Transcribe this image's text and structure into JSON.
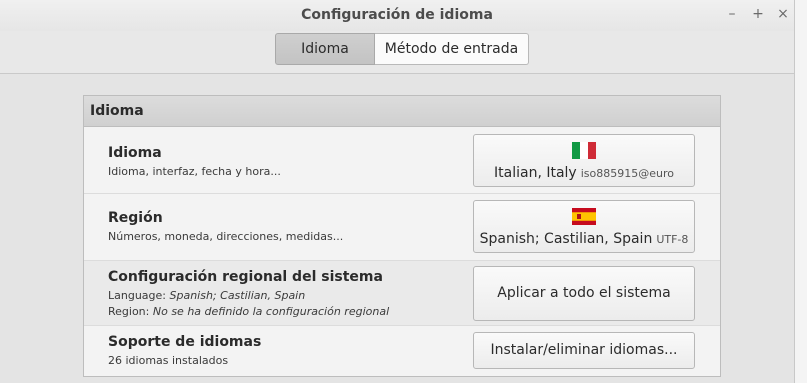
{
  "window": {
    "title": "Configuración de idioma",
    "controls": {
      "minimize": "–",
      "maximize": "+",
      "close": "×"
    }
  },
  "tabs": [
    {
      "label": "Idioma",
      "active": true
    },
    {
      "label": "Método de entrada",
      "active": false
    }
  ],
  "section": {
    "header": "Idioma"
  },
  "rows": {
    "language": {
      "title": "Idioma",
      "subtitle": "Idioma, interfaz, fecha y hora...",
      "button_main": "Italian, Italy",
      "button_secondary": "iso885915@euro",
      "flag_icon": "italy-flag-icon"
    },
    "region": {
      "title": "Región",
      "subtitle": "Números, moneda, direcciones, medidas...",
      "button_main": "Spanish; Castilian, Spain",
      "button_secondary": "UTF-8",
      "flag_icon": "spain-flag-icon"
    },
    "system": {
      "title": "Configuración regional del sistema",
      "language_label": "Language:",
      "language_value": "Spanish; Castilian, Spain",
      "region_label": "Region:",
      "region_value": "No se ha definido la configuración regional",
      "button": "Aplicar a todo el sistema"
    },
    "support": {
      "title": "Soporte de idiomas",
      "subtitle": "26 idiomas instalados",
      "button": "Instalar/eliminar idiomas..."
    }
  },
  "colors": {
    "window_bg": "#e4e4e4",
    "header_bg": "#d4d4d4",
    "active_tab": "#c8c8c8"
  }
}
